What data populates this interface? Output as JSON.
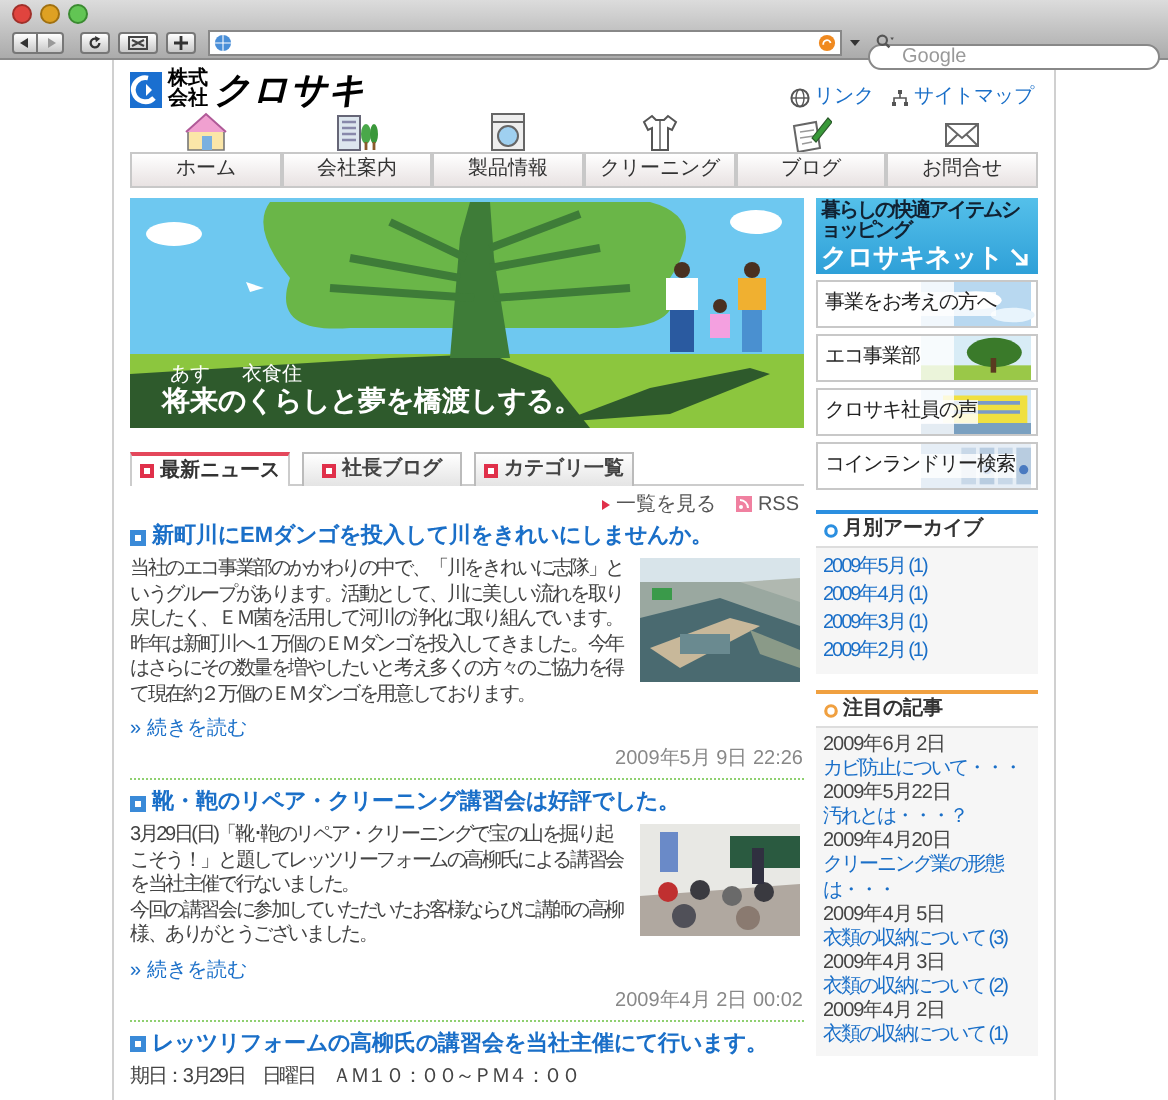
{
  "browser": {
    "search": {
      "placeholder": "Google"
    }
  },
  "header": {
    "logo": {
      "prefix": "株式会社",
      "name": "クロサキ"
    },
    "links": [
      {
        "label": "リンク",
        "kind": "globe"
      },
      {
        "label": "サイトマップ",
        "kind": "sitemap"
      }
    ]
  },
  "nav": [
    {
      "label": "ホーム",
      "kind": "house"
    },
    {
      "label": "会社案内",
      "kind": "building"
    },
    {
      "label": "製品情報",
      "kind": "washer"
    },
    {
      "label": "クリーニング",
      "kind": "shirt"
    },
    {
      "label": "ブログ",
      "kind": "notepad"
    },
    {
      "label": "お問合せ",
      "kind": "envelope"
    }
  ],
  "hero": {
    "kind": "picture",
    "furigana": [
      "あす",
      "衣食住"
    ],
    "tagline": "将来のくらしと夢を橋渡しする。"
  },
  "tabs": [
    {
      "label": "最新ニュース",
      "selected": true
    },
    {
      "label": "社長ブログ",
      "selected": false
    },
    {
      "label": "カテゴリ一覧",
      "selected": false
    }
  ],
  "tab_links": [
    {
      "label": "一覧を見る",
      "kind": "arrow"
    },
    {
      "label": "RSS",
      "kind": "rss"
    }
  ],
  "articles": [
    {
      "title": "新町川にEMダンゴを投入して川をきれいにしませんか。",
      "body": [
        "当社のエコ事業部のかかわりの中で、「川をきれいに志隊」というグループがあります。活動として、川に美しい流れを取り戻したく、ＥＭ菌を活用して河川の浄化に取り組んでいます。昨年は新町川へ１万個のＥＭダンゴを投入してきました。今年はさらにその数量を増やしたいと考え多くの方々のご協力を得て現在約２万個のＥＭダンゴを用意しております。"
      ],
      "image": {
        "kind": "picture"
      },
      "more": "» 続きを読む",
      "date": "2009年5月 9日 22:26"
    },
    {
      "title": "靴・鞄のリペア・クリーニング講習会は好評でした。",
      "body": [
        "3月29日(日)「靴･鞄のリペア・クリーニングで宝の山を掘り起こそう！」と題してレッツリーフォームの高柳氏による講習会を当社主催で行ないました。",
        "今回の講習会に参加していただいたお客様ならびに講師の高柳様、ありがとうございました。"
      ],
      "image": {
        "kind": "picture"
      },
      "more": "» 続きを読む",
      "date": "2009年4月 2日 00:02"
    },
    {
      "title": "レッツリフォームの高柳氏の講習会を当社主催にて行います。",
      "body": [
        "期日：3月29日　日曜日　ＡＭ１０：００～ＰＭ４：００"
      ]
    }
  ],
  "shop_banner": {
    "tagline": "暮らしの快適アイテムショッピング",
    "name": "クロサキネット"
  },
  "menu": [
    {
      "label": "事業をお考えの方へ",
      "image": {
        "kind": "picture"
      }
    },
    {
      "label": "エコ事業部",
      "image": {
        "kind": "picture"
      }
    },
    {
      "label": "クロサキ社員の声",
      "image": {
        "kind": "picture"
      }
    },
    {
      "label": "コインランドリー検索",
      "image": {
        "kind": "picture"
      }
    }
  ],
  "widgets": [
    {
      "title": "月別アーカイブ",
      "color": "#2b8fe0",
      "kind": "links",
      "items": [
        {
          "title": "2009年5月 (1)"
        },
        {
          "title": "2009年4月 (1)"
        },
        {
          "title": "2009年3月 (1)"
        },
        {
          "title": "2009年2月 (1)"
        }
      ]
    },
    {
      "title": "注目の記事",
      "color": "#f0a040",
      "kind": "dated",
      "items": [
        {
          "date": "2009年6月 2日",
          "title": "カビ防止について・・・"
        },
        {
          "date": "2009年5月22日",
          "title": "汚れとは・・・？"
        },
        {
          "date": "2009年4月20日",
          "title": "クリーニング業の形態は・・・"
        },
        {
          "date": "2009年4月 5日",
          "title": "衣類の収納について (3)"
        },
        {
          "date": "2009年4月 3日",
          "title": "衣類の収納について (2)"
        },
        {
          "date": "2009年4月 2日",
          "title": "衣類の収納について (1)"
        }
      ]
    }
  ]
}
